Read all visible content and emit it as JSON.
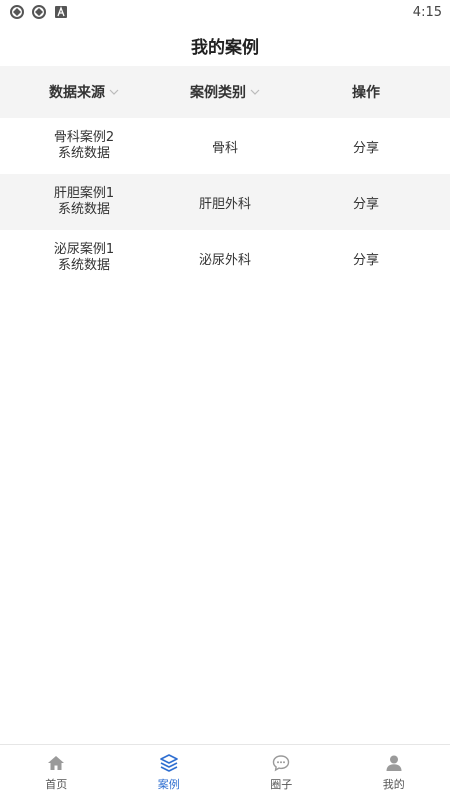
{
  "status_bar": {
    "time": "4:15",
    "icons": [
      "sync-icon",
      "sync-icon",
      "a-badge-icon"
    ]
  },
  "header": {
    "title": "我的案例"
  },
  "table": {
    "columns": [
      {
        "label": "数据来源",
        "sortable": true
      },
      {
        "label": "案例类别",
        "sortable": true
      },
      {
        "label": "操作",
        "sortable": false
      }
    ],
    "rows": [
      {
        "source_line1": "骨科案例2",
        "source_line2": "系统数据",
        "category": "骨科",
        "action": "分享"
      },
      {
        "source_line1": "肝胆案例1",
        "source_line2": "系统数据",
        "category": "肝胆外科",
        "action": "分享"
      },
      {
        "source_line1": "泌尿案例1",
        "source_line2": "系统数据",
        "category": "泌尿外科",
        "action": "分享"
      }
    ]
  },
  "tab_bar": {
    "active_color": "#2f6fd1",
    "tabs": [
      {
        "label": "首页",
        "icon": "home-icon",
        "active": false
      },
      {
        "label": "案例",
        "icon": "layers-icon",
        "active": true
      },
      {
        "label": "圈子",
        "icon": "chat-bubble-icon",
        "active": false
      },
      {
        "label": "我的",
        "icon": "user-icon",
        "active": false
      }
    ]
  }
}
